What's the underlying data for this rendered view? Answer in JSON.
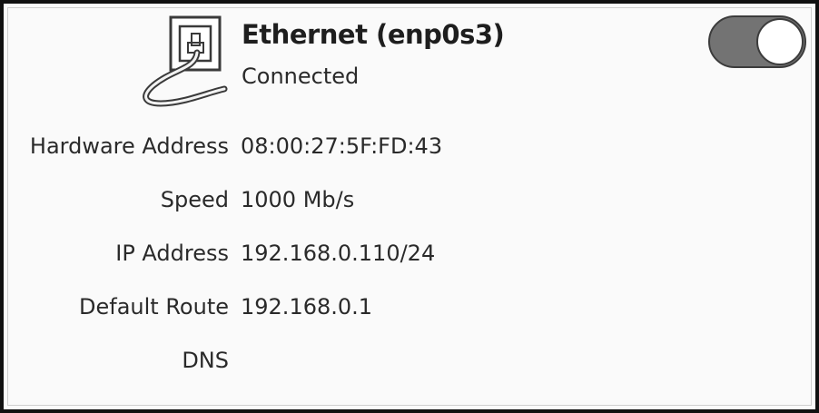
{
  "connection": {
    "name": "Ethernet (enp0s3)",
    "status": "Connected",
    "icon": "ethernet-port-icon",
    "toggle": {
      "state": "on",
      "accent": "#737373"
    }
  },
  "details": [
    {
      "label": "Hardware Address",
      "value": "08:00:27:5F:FD:43"
    },
    {
      "label": "Speed",
      "value": "1000 Mb/s"
    },
    {
      "label": "IP Address",
      "value": "192.168.0.110/24"
    },
    {
      "label": "Default Route",
      "value": "192.168.0.1"
    },
    {
      "label": "DNS",
      "value": ""
    }
  ]
}
